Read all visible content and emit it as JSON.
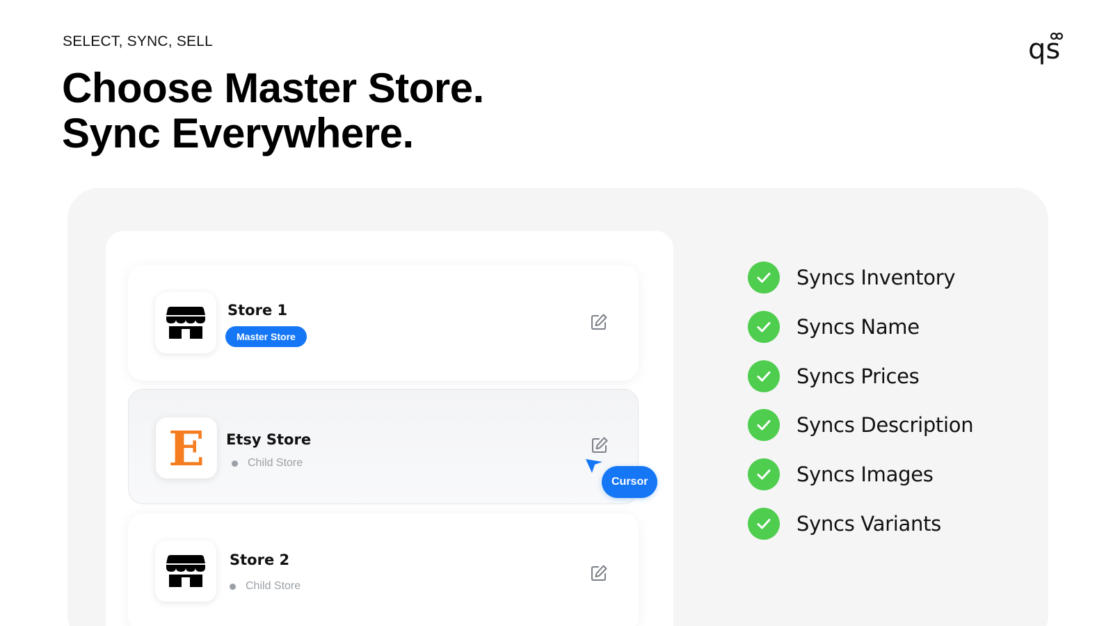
{
  "header": {
    "eyebrow": "SELECT, SYNC, SELL",
    "headline_line1": "Choose Master Store.",
    "headline_line2": "Sync Everywhere."
  },
  "logo": {
    "text": "qs",
    "icon": "infinity-icon"
  },
  "stores": [
    {
      "name": "Store 1",
      "role": "Master Store",
      "icon": "storefront-icon"
    },
    {
      "name": "Etsy Store",
      "role": "Child Store",
      "icon": "etsy-logo",
      "logo_letter": "E"
    },
    {
      "name": "Store 2",
      "role": "Child Store",
      "icon": "storefront-icon"
    }
  ],
  "cursor": {
    "label": "Cursor"
  },
  "features": [
    "Syncs Inventory",
    "Syncs Name",
    "Syncs Prices",
    "Syncs Description",
    "Syncs Images",
    "Syncs Variants"
  ],
  "colors": {
    "accent": "#1577f5",
    "check": "#4fcd4f",
    "etsy": "#f57d1f",
    "panel_bg": "#f5f5f5"
  }
}
